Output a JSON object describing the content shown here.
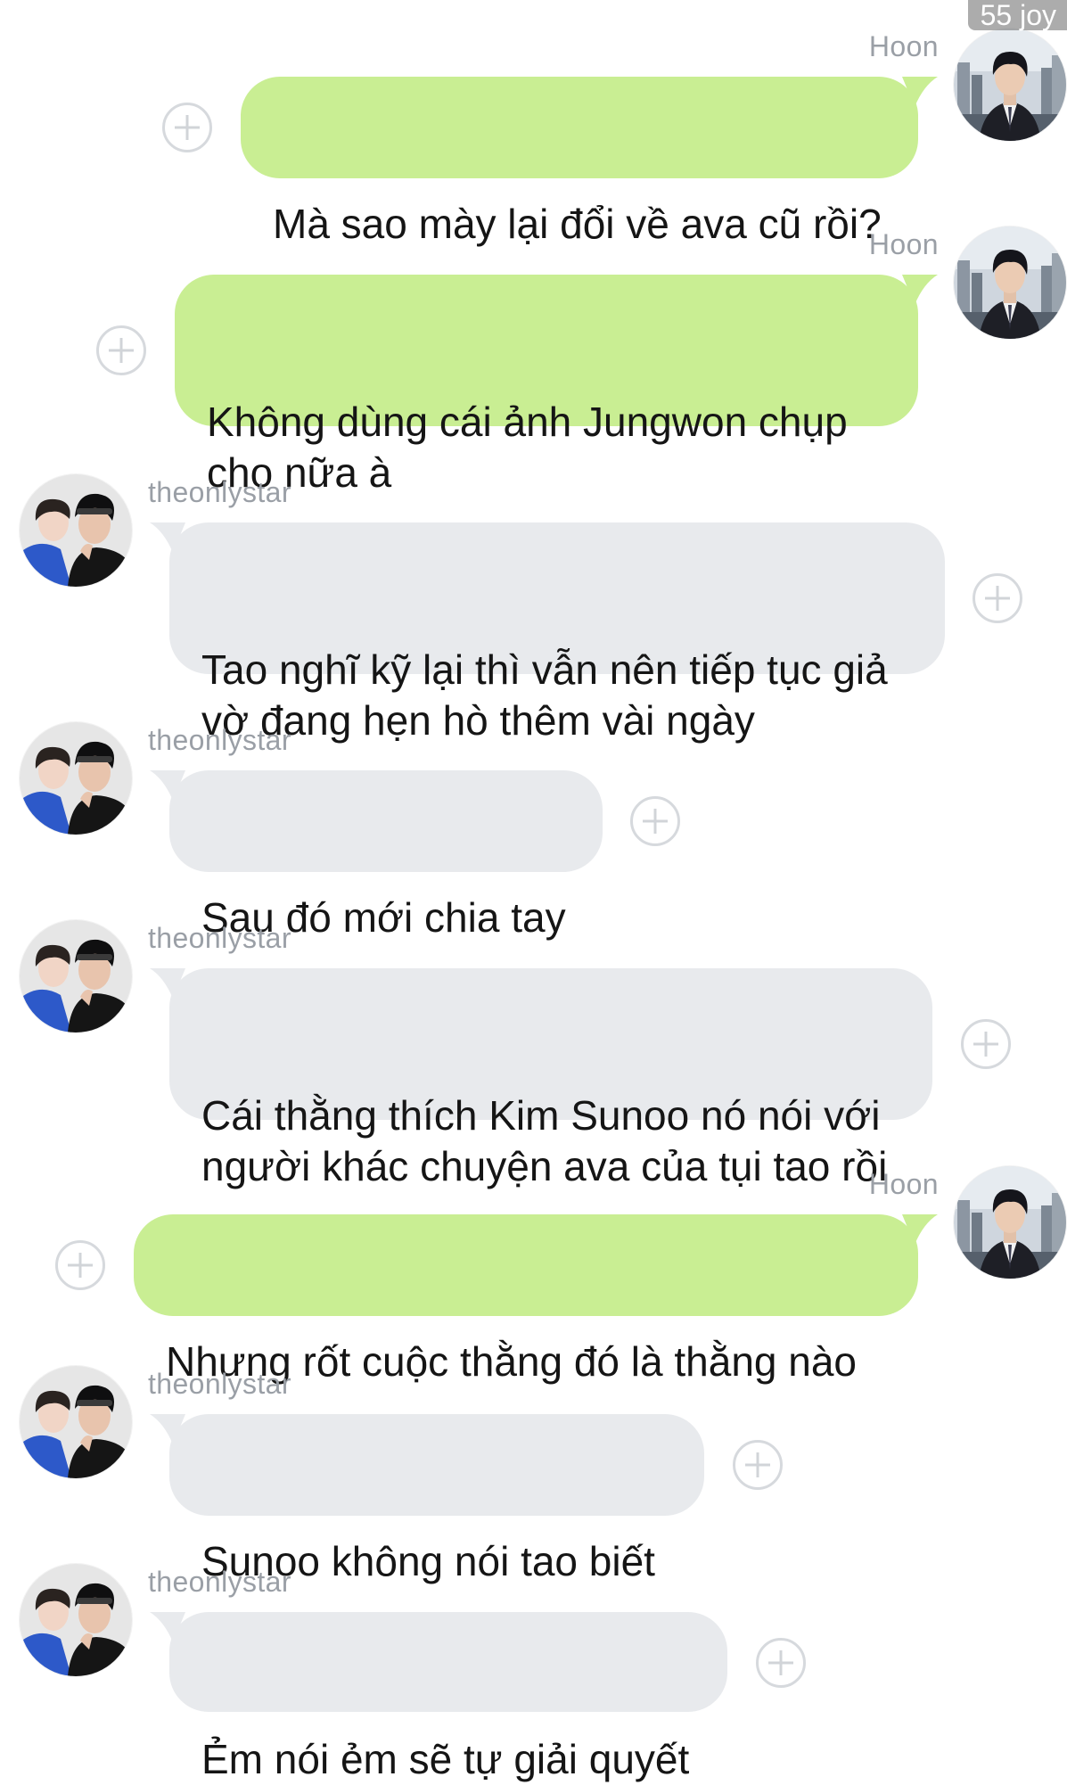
{
  "watermark": "55 joy",
  "colors": {
    "outgoing_bubble": "#c9ee93",
    "incoming_bubble": "#e8eaed",
    "name_text": "#9a9fa6",
    "add_icon": "#d1d4d8"
  },
  "messages": [
    {
      "sender": "Hoon",
      "direction": "outgoing",
      "text": "Mà sao mày lại đổi về ava cũ rồi?"
    },
    {
      "sender": "Hoon",
      "direction": "outgoing",
      "text": "Không dùng cái ảnh Jungwon chụp\ncho nữa à"
    },
    {
      "sender": "theonlystar",
      "direction": "incoming",
      "text": "Tao nghĩ kỹ lại thì vẫn nên tiếp tục giả\nvờ đang hẹn hò thêm vài ngày"
    },
    {
      "sender": "theonlystar",
      "direction": "incoming",
      "text": "Sau đó mới chia tay"
    },
    {
      "sender": "theonlystar",
      "direction": "incoming",
      "text": "Cái thằng thích Kim Sunoo nó nói với\nngười khác chuyện ava của tụi tao rồi"
    },
    {
      "sender": "Hoon",
      "direction": "outgoing",
      "text": "Nhưng rốt cuộc thằng đó là thằng nào"
    },
    {
      "sender": "theonlystar",
      "direction": "incoming",
      "text": "Sunoo không nói tao biết"
    },
    {
      "sender": "theonlystar",
      "direction": "incoming",
      "text": "Ẻm nói ẻm sẽ tự giải quyết"
    }
  ]
}
